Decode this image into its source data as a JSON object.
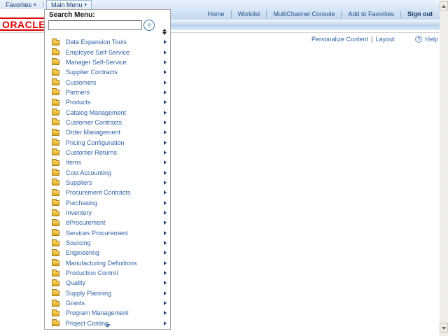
{
  "header": {
    "tabs": {
      "favorites": "Favorites",
      "main_menu": "Main Menu"
    },
    "links": [
      "Home",
      "Worklist",
      "MultiChannel Console",
      "Add to Favorites",
      "Sign out"
    ],
    "brand": "ORACLE",
    "personalize_content": "Personalize Content",
    "separator": "|",
    "layout": "Layout",
    "help": "Help",
    "help_glyph": "?"
  },
  "menu_dropdown": {
    "search_label": "Search Menu:",
    "search_value": "",
    "search_placeholder": "",
    "go_glyph": "»",
    "items": [
      {
        "label": "Data Expansion Tools"
      },
      {
        "label": "Employee Self-Service"
      },
      {
        "label": "Manager Self-Service"
      },
      {
        "label": "Supplier Contracts"
      },
      {
        "label": "Customers"
      },
      {
        "label": "Partners"
      },
      {
        "label": "Products"
      },
      {
        "label": "Catalog Management"
      },
      {
        "label": "Customer Contracts"
      },
      {
        "label": "Order Management"
      },
      {
        "label": "Pricing Configuration"
      },
      {
        "label": "Customer Returns"
      },
      {
        "label": "Items"
      },
      {
        "label": "Cost Accounting"
      },
      {
        "label": "Suppliers"
      },
      {
        "label": "Procurement Contracts"
      },
      {
        "label": "Purchasing"
      },
      {
        "label": "Inventory"
      },
      {
        "label": "eProcurement"
      },
      {
        "label": "Services Procurement"
      },
      {
        "label": "Sourcing"
      },
      {
        "label": "Engineering"
      },
      {
        "label": "Manufacturing Definitions"
      },
      {
        "label": "Production Control"
      },
      {
        "label": "Quality"
      },
      {
        "label": "Supply Planning"
      },
      {
        "label": "Grants"
      },
      {
        "label": "Program Management"
      },
      {
        "label": "Project Costing"
      }
    ]
  },
  "colors": {
    "oracle_red": "#e00000",
    "link_blue": "#24508f",
    "menu_item_blue": "#2e62a6",
    "bar_blue": "#c3d8ee"
  }
}
